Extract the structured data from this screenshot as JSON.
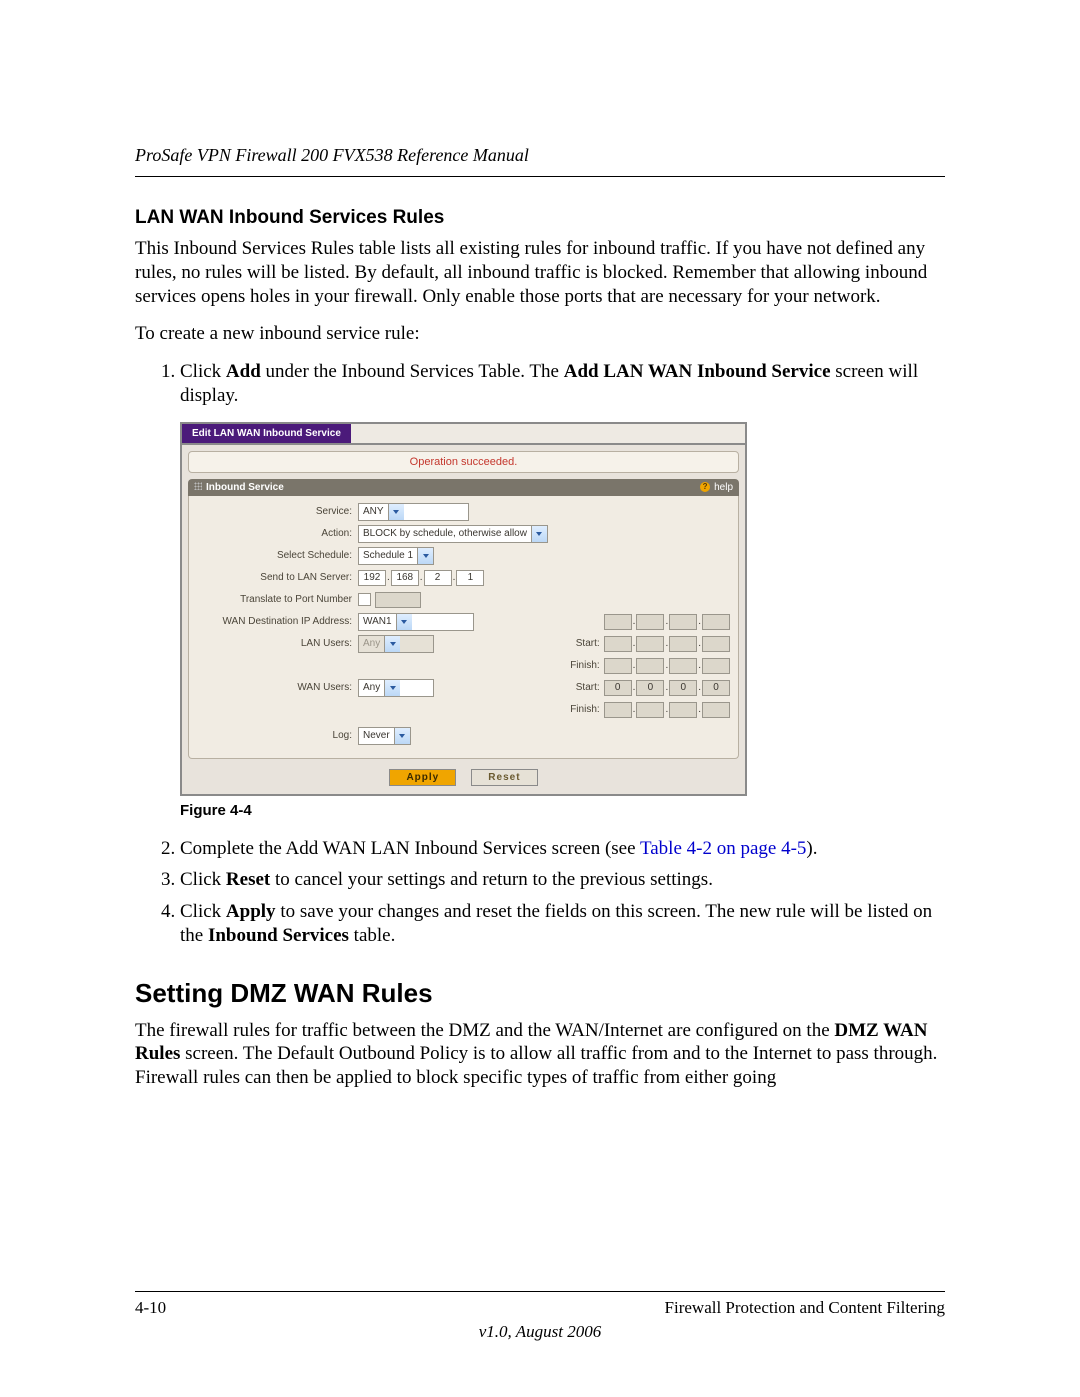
{
  "header": {
    "running_title": "ProSafe VPN Firewall 200 FVX538 Reference Manual"
  },
  "section1": {
    "heading": "LAN WAN Inbound Services Rules",
    "para1": "This Inbound Services Rules table lists all existing rules for inbound traffic. If you have not defined any rules, no rules will be listed. By default, all inbound traffic is blocked. Remember that allowing inbound services opens holes in your firewall. Only enable those ports that are necessary for your network.",
    "para2": "To create a new inbound service rule:",
    "step1_a": "Click ",
    "step1_b": "Add",
    "step1_c": " under the Inbound Services Table. The ",
    "step1_d": "Add LAN WAN Inbound Service",
    "step1_e": " screen will display."
  },
  "figure": {
    "caption": "Figure 4-4",
    "tab_title": "Edit LAN WAN Inbound Service",
    "status_msg": "Operation succeeded.",
    "section_title": "Inbound Service",
    "help_label": "help",
    "labels": {
      "service": "Service:",
      "action": "Action:",
      "schedule": "Select Schedule:",
      "send_lan": "Send to LAN Server:",
      "translate": "Translate to Port Number",
      "wan_dest": "WAN Destination IP Address:",
      "lan_users": "LAN Users:",
      "wan_users": "WAN Users:",
      "log": "Log:",
      "start": "Start:",
      "finish": "Finish:"
    },
    "values": {
      "service": "ANY",
      "action": "BLOCK by schedule, otherwise allow",
      "schedule": "Schedule 1",
      "ip": [
        "192",
        "168",
        "2",
        "1"
      ],
      "translate_port": "",
      "wan_dest": "WAN1",
      "lan_users": "Any",
      "wan_users": "Any",
      "log": "Never",
      "wan_start": [
        "0",
        "0",
        "0",
        "0"
      ]
    },
    "buttons": {
      "apply": "Apply",
      "reset": "Reset"
    }
  },
  "after_figure": {
    "step2_a": "Complete the Add WAN LAN Inbound Services screen (see ",
    "step2_link": "Table 4-2 on page 4-5",
    "step2_b": ").",
    "step3_a": "Click ",
    "step3_b": "Reset",
    "step3_c": " to cancel your settings and return to the previous settings.",
    "step4_a": "Click ",
    "step4_b": "Apply",
    "step4_c": " to save your changes and reset the fields on this screen. The new rule will be listed on the ",
    "step4_d": "Inbound Services",
    "step4_e": " table."
  },
  "section2": {
    "heading": "Setting DMZ WAN Rules",
    "para_a": "The firewall rules for traffic between the DMZ and the WAN/Internet are configured on the ",
    "para_b": "DMZ WAN Rules",
    "para_c": " screen. The Default Outbound Policy is to allow all traffic from and to the Internet to pass through. Firewall rules can then be applied to block specific types of traffic from either going"
  },
  "footer": {
    "page_num": "4-10",
    "chapter": "Firewall Protection and Content Filtering",
    "version": "v1.0, August 2006"
  }
}
